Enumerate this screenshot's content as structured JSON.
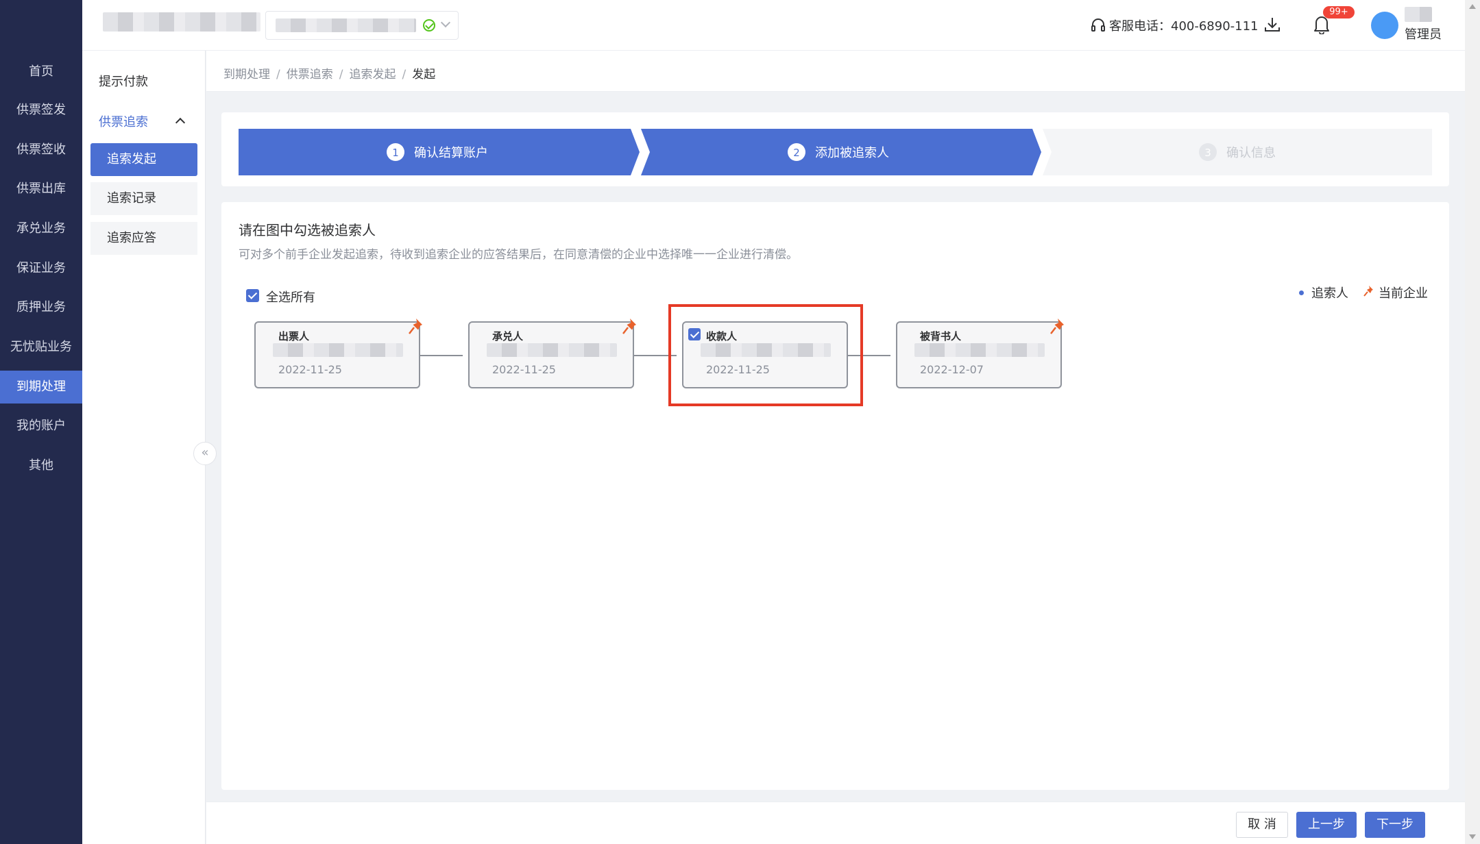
{
  "sidebar": {
    "items": [
      {
        "label": "首页"
      },
      {
        "label": "供票签发"
      },
      {
        "label": "供票签收"
      },
      {
        "label": "供票出库"
      },
      {
        "label": "承兑业务"
      },
      {
        "label": "保证业务"
      },
      {
        "label": "质押业务"
      },
      {
        "label": "无忧贴业务"
      },
      {
        "label": "到期处理",
        "active": true
      },
      {
        "label": "我的账户"
      },
      {
        "label": "其他"
      }
    ]
  },
  "header": {
    "hotline_label": "客服电话：400-6890-111",
    "notification_badge": "99+",
    "user_role": "管理员",
    "icons": [
      "headset-icon",
      "download-icon",
      "bell-icon"
    ]
  },
  "subnav": {
    "item_payment_prompt": "提示付款",
    "group_recourse": "供票追索",
    "children": [
      {
        "label": "追索发起",
        "active": true
      },
      {
        "label": "追索记录"
      },
      {
        "label": "追索应答"
      }
    ],
    "collapse_glyph": "«"
  },
  "breadcrumb": {
    "items": [
      "到期处理",
      "供票追索",
      "追索发起"
    ],
    "current": "发起",
    "separator": "/"
  },
  "steps": [
    {
      "num": "1",
      "label": "确认结算账户",
      "state": "done"
    },
    {
      "num": "2",
      "label": "添加被追索人",
      "state": "active"
    },
    {
      "num": "3",
      "label": "确认信息",
      "state": "pending"
    }
  ],
  "panel": {
    "title": "请在图中勾选被追索人",
    "description": "可对多个前手企业发起追索，待收到追索企业的应答结果后，在同意清偿的企业中选择唯一一企业进行清偿。",
    "select_all_label": "全选所有",
    "legend": {
      "recourser": "追索人",
      "current_company": "当前企业"
    }
  },
  "chain": [
    {
      "role": "出票人",
      "date": "2022-11-25",
      "pinned": true,
      "checked": false
    },
    {
      "role": "承兑人",
      "date": "2022-11-25",
      "pinned": true,
      "checked": false
    },
    {
      "role": "收款人",
      "date": "2022-11-25",
      "pinned": false,
      "checked": true
    },
    {
      "role": "被背书人",
      "date": "2022-12-07",
      "pinned": true,
      "checked": false
    }
  ],
  "footer": {
    "cancel": "取 消",
    "prev": "上一步",
    "next": "下一步"
  },
  "colors": {
    "sidebar_bg": "#232a4d",
    "accent": "#4b6fd2",
    "highlight_border": "#e53a26",
    "pin": "#e8622c",
    "badge": "#f04438"
  }
}
